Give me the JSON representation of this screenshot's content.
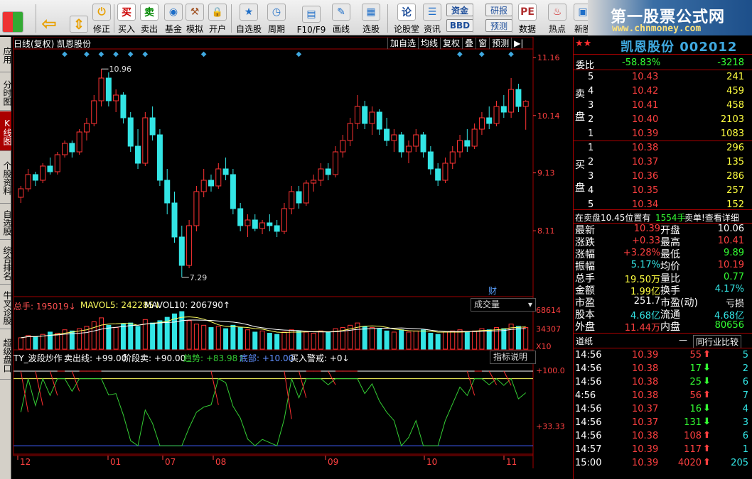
{
  "toolbar": {
    "buttons": [
      {
        "label": "",
        "icon": "windows-icon"
      },
      {
        "label": "",
        "icon": "back-arrow-icon"
      },
      {
        "label": "",
        "icon": "up-down-arrows-icon"
      },
      {
        "label": "修正",
        "icon": "correct-icon"
      },
      {
        "label": "买入",
        "icon": "buy-icon",
        "glyph": "买"
      },
      {
        "label": "卖出",
        "icon": "sell-icon",
        "glyph": "卖"
      },
      {
        "label": "基金",
        "icon": "fund-icon"
      },
      {
        "label": "模拟",
        "icon": "simulate-icon"
      },
      {
        "label": "开户",
        "icon": "lock-icon"
      },
      {
        "label": "自选股",
        "icon": "star-list-icon"
      },
      {
        "label": "周期",
        "icon": "clock-icon"
      },
      {
        "label": "F10/F9",
        "icon": "f10-icon"
      },
      {
        "label": "画线",
        "icon": "pen-icon"
      },
      {
        "label": "选股",
        "icon": "chart-select-icon"
      },
      {
        "label": "论股堂",
        "icon": "forum-icon",
        "glyph": "论"
      },
      {
        "label": "资讯",
        "icon": "news-icon"
      },
      {
        "label": "资金",
        "icon": "capital-icon"
      },
      {
        "label": "BBD",
        "icon": "bbd-icon"
      },
      {
        "label": "研报",
        "icon": "report-icon"
      },
      {
        "label": "预测",
        "icon": "forecast-icon"
      },
      {
        "label": "数据",
        "icon": "pe-icon",
        "glyph": "PE"
      },
      {
        "label": "热点",
        "icon": "hot-icon"
      },
      {
        "label": "新股",
        "icon": "ipo-icon"
      }
    ]
  },
  "logo": {
    "title": "第一股票公式网",
    "url": "www.chnmoney.com"
  },
  "left_tabs": [
    "应用",
    "分时图",
    "K线图",
    "个股资料",
    "自选股",
    "综合排名",
    "牛叉诊股",
    "超级盘口"
  ],
  "chart_header": {
    "mode": "日线(复权)",
    "stock": "凯恩股份",
    "buttons": [
      "加自选",
      "均线",
      "复权",
      "叠",
      "窗",
      "预测",
      "▶|"
    ]
  },
  "price_axis": [
    "11.16",
    "10.14",
    "9.13",
    "8.11"
  ],
  "annotations": {
    "high": "10.96",
    "low": "7.29",
    "fin_marker": "财"
  },
  "volume_header": {
    "label": "总手: 195019↓",
    "mavol5": "MAVOL5: 242285↓",
    "mavol10": "MAVOL10: 206790↑",
    "combo": "成交量"
  },
  "volume_axis": [
    "68614",
    "34307",
    "X10"
  ],
  "indicator_header": {
    "name": "TY_波段炒作",
    "sell_line": "卖出线: +99.00",
    "stage_sell": "阶段卖: +90.00",
    "trend": "趋势: +83.98↑",
    "bottom": "底部: +10.00",
    "buy_alert": "买入警戒: +0↓",
    "button": "指标说明"
  },
  "indicator_axis": [
    "+100.0",
    "+33.33"
  ],
  "date_axis": [
    "12",
    "01",
    "07",
    "08",
    "09",
    "10",
    "11"
  ],
  "chart_data": {
    "type": "candlestick",
    "series": [
      {
        "name": "K线",
        "values": [
          [
            8.7,
            8.9,
            8.6,
            8.85
          ],
          [
            8.85,
            9.2,
            8.8,
            9.1
          ],
          [
            9.1,
            9.15,
            8.9,
            9.0
          ],
          [
            9.0,
            9.3,
            8.95,
            9.25
          ],
          [
            9.25,
            9.4,
            9.1,
            9.15
          ],
          [
            9.15,
            9.5,
            9.1,
            9.45
          ],
          [
            9.45,
            9.7,
            9.4,
            9.65
          ],
          [
            9.65,
            9.7,
            9.4,
            9.5
          ],
          [
            9.5,
            9.9,
            9.45,
            9.85
          ],
          [
            9.85,
            10.1,
            9.7,
            10.0
          ],
          [
            10.0,
            10.5,
            9.95,
            10.4
          ],
          [
            10.4,
            10.96,
            10.3,
            10.8
          ],
          [
            10.8,
            10.9,
            10.3,
            10.4
          ],
          [
            10.4,
            10.6,
            10.2,
            10.5
          ],
          [
            10.5,
            10.55,
            10.0,
            10.1
          ],
          [
            10.1,
            10.2,
            9.5,
            9.6
          ],
          [
            9.6,
            9.9,
            9.2,
            9.3
          ],
          [
            9.3,
            10.2,
            9.25,
            10.1
          ],
          [
            10.1,
            10.3,
            9.7,
            9.8
          ],
          [
            9.8,
            9.9,
            8.9,
            9.0
          ],
          [
            9.0,
            9.2,
            8.4,
            8.6
          ],
          [
            8.6,
            8.8,
            7.9,
            8.0
          ],
          [
            8.0,
            8.2,
            7.29,
            7.5
          ],
          [
            7.5,
            8.3,
            7.45,
            8.2
          ],
          [
            8.2,
            8.9,
            8.1,
            8.8
          ],
          [
            8.8,
            9.2,
            8.7,
            9.0
          ],
          [
            9.0,
            9.1,
            8.8,
            8.9
          ],
          [
            8.9,
            9.3,
            8.85,
            9.2
          ],
          [
            9.2,
            9.4,
            9.0,
            9.1
          ],
          [
            9.1,
            9.2,
            8.4,
            8.5
          ],
          [
            8.5,
            8.6,
            8.1,
            8.2
          ],
          [
            8.2,
            8.4,
            8.0,
            8.3
          ],
          [
            8.3,
            8.4,
            8.1,
            8.15
          ],
          [
            8.15,
            8.3,
            8.05,
            8.25
          ],
          [
            8.25,
            8.4,
            8.1,
            8.2
          ],
          [
            8.2,
            8.3,
            8.0,
            8.1
          ],
          [
            8.1,
            8.6,
            8.05,
            8.5
          ],
          [
            8.5,
            8.9,
            8.4,
            8.8
          ],
          [
            8.8,
            8.9,
            8.5,
            8.6
          ],
          [
            8.6,
            9.0,
            8.55,
            8.95
          ],
          [
            8.95,
            9.1,
            8.8,
            9.0
          ],
          [
            9.0,
            9.3,
            8.9,
            9.2
          ],
          [
            9.2,
            9.3,
            9.0,
            9.1
          ],
          [
            9.1,
            9.6,
            9.05,
            9.5
          ],
          [
            9.5,
            9.8,
            9.4,
            9.7
          ],
          [
            9.7,
            10.1,
            9.6,
            10.0
          ],
          [
            10.0,
            10.5,
            9.9,
            10.3
          ],
          [
            10.3,
            10.4,
            9.9,
            10.0
          ],
          [
            10.0,
            10.3,
            9.8,
            10.2
          ],
          [
            10.2,
            10.25,
            9.8,
            9.9
          ],
          [
            9.9,
            10.1,
            9.6,
            9.7
          ],
          [
            9.7,
            9.9,
            9.5,
            9.8
          ],
          [
            9.8,
            9.85,
            9.4,
            9.5
          ],
          [
            9.5,
            9.7,
            9.3,
            9.6
          ],
          [
            9.6,
            9.9,
            9.5,
            9.8
          ],
          [
            9.8,
            9.85,
            9.4,
            9.5
          ],
          [
            9.5,
            9.6,
            9.1,
            9.2
          ],
          [
            9.2,
            9.3,
            8.9,
            9.0
          ],
          [
            9.0,
            9.4,
            8.95,
            9.3
          ],
          [
            9.3,
            9.6,
            9.2,
            9.5
          ],
          [
            9.5,
            9.8,
            9.4,
            9.7
          ],
          [
            9.7,
            9.9,
            9.5,
            9.6
          ],
          [
            9.6,
            10.0,
            9.55,
            9.9
          ],
          [
            9.9,
            10.2,
            9.8,
            10.1
          ],
          [
            10.1,
            10.3,
            9.9,
            10.0
          ],
          [
            10.0,
            10.4,
            9.95,
            10.3
          ],
          [
            10.3,
            10.5,
            10.1,
            10.2
          ],
          [
            10.2,
            10.8,
            10.1,
            10.6
          ],
          [
            10.6,
            10.7,
            10.2,
            10.3
          ],
          [
            10.3,
            10.41,
            9.89,
            10.39
          ]
        ]
      }
    ],
    "ylim": [
      7.0,
      11.3
    ],
    "volume": [
      20,
      24,
      22,
      26,
      30,
      28,
      34,
      32,
      36,
      40,
      48,
      55,
      42,
      38,
      44,
      46,
      40,
      52,
      46,
      50,
      56,
      62,
      66,
      50,
      44,
      42,
      38,
      40,
      36,
      42,
      38,
      34,
      30,
      32,
      28,
      26,
      30,
      34,
      32,
      30,
      28,
      32,
      30,
      36,
      38,
      42,
      46,
      40,
      38,
      36,
      32,
      30,
      34,
      30,
      32,
      34,
      28,
      26,
      30,
      32,
      34,
      30,
      32,
      36,
      34,
      38,
      36,
      44,
      40,
      38
    ],
    "volume_ylim": [
      0,
      68614
    ],
    "indicator_ylim": [
      0,
      110
    ]
  },
  "quote": {
    "stock_title": "凯恩股份 002012",
    "weibi_label": "委比",
    "weibi": "-58.83%",
    "weicha": "-3218",
    "sell_label": [
      "卖",
      "盘"
    ],
    "buy_label": [
      "买",
      "盘"
    ],
    "sell": [
      {
        "n": "5",
        "price": "10.43",
        "vol": "241"
      },
      {
        "n": "4",
        "price": "10.42",
        "vol": "459"
      },
      {
        "n": "3",
        "price": "10.41",
        "vol": "458"
      },
      {
        "n": "2",
        "price": "10.40",
        "vol": "2103"
      },
      {
        "n": "1",
        "price": "10.39",
        "vol": "1083"
      }
    ],
    "buy": [
      {
        "n": "1",
        "price": "10.38",
        "vol": "296"
      },
      {
        "n": "2",
        "price": "10.37",
        "vol": "135"
      },
      {
        "n": "3",
        "price": "10.36",
        "vol": "286"
      },
      {
        "n": "4",
        "price": "10.35",
        "vol": "257"
      },
      {
        "n": "5",
        "price": "10.34",
        "vol": "152"
      }
    ],
    "notice": "在卖盘10.45位置有",
    "notice_vol": "1554手",
    "notice_tail": "卖单!查看详细",
    "stats": [
      {
        "l1": "最新",
        "v1": "10.39",
        "l2": "开盘",
        "v2": "10.06",
        "c1": "red",
        "c2": "wht"
      },
      {
        "l1": "涨跌",
        "v1": "+0.33",
        "l2": "最高",
        "v2": "10.41",
        "c1": "red",
        "c2": "red"
      },
      {
        "l1": "涨幅",
        "v1": "+3.28%",
        "l2": "最低",
        "v2": "9.89",
        "c1": "red",
        "c2": "green"
      },
      {
        "l1": "振幅",
        "v1": "5.17%",
        "l2": "均价",
        "v2": "10.19",
        "c1": "cyan",
        "c2": "red"
      },
      {
        "l1": "总手",
        "v1": "19.50万",
        "l2": "量比",
        "v2": "0.77",
        "c1": "yel",
        "c2": "green"
      },
      {
        "l1": "金额",
        "v1": "1.99亿",
        "l2": "换手",
        "v2": "4.17%",
        "c1": "yel",
        "c2": "cyan"
      },
      {
        "l1": "市盈",
        "v1": "251.7",
        "l2": "市盈(动)",
        "v2": "亏损",
        "c1": "wht",
        "c2": "wht"
      },
      {
        "l1": "股本",
        "v1": "4.68亿",
        "l2": "流通",
        "v2": "4.68亿",
        "c1": "cyan",
        "c2": "cyan"
      },
      {
        "l1": "外盘",
        "v1": "11.44万",
        "l2": "内盘",
        "v2": "80656",
        "c1": "red",
        "c2": "green"
      }
    ],
    "tabs": [
      "道纸",
      "—",
      "同行业比较"
    ],
    "ticks": [
      {
        "time": "14:56",
        "price": "10.39",
        "vol": "55",
        "dir": "up",
        "n": "5"
      },
      {
        "time": "14:56",
        "price": "10.38",
        "vol": "17",
        "dir": "down",
        "n": "2"
      },
      {
        "time": "14:56",
        "price": "10.38",
        "vol": "25",
        "dir": "down",
        "n": "6"
      },
      {
        "time": "4:56",
        "price": "10.38",
        "vol": "56",
        "dir": "up",
        "n": "7"
      },
      {
        "time": "14:56",
        "price": "10.37",
        "vol": "16",
        "dir": "down",
        "n": "4"
      },
      {
        "time": "14:56",
        "price": "10.37",
        "vol": "131",
        "dir": "down",
        "n": "3"
      },
      {
        "time": "14:56",
        "price": "10.38",
        "vol": "108",
        "dir": "up",
        "n": "6"
      },
      {
        "time": "14:57",
        "price": "10.39",
        "vol": "117",
        "dir": "up",
        "n": "1"
      },
      {
        "time": "15:00",
        "price": "10.39",
        "vol": "4020",
        "dir": "up",
        "n": "205"
      }
    ]
  },
  "colors": {
    "up": "#ff3333",
    "down": "#33e5e5",
    "grid": "#a00000",
    "axis": "#ff4040"
  }
}
